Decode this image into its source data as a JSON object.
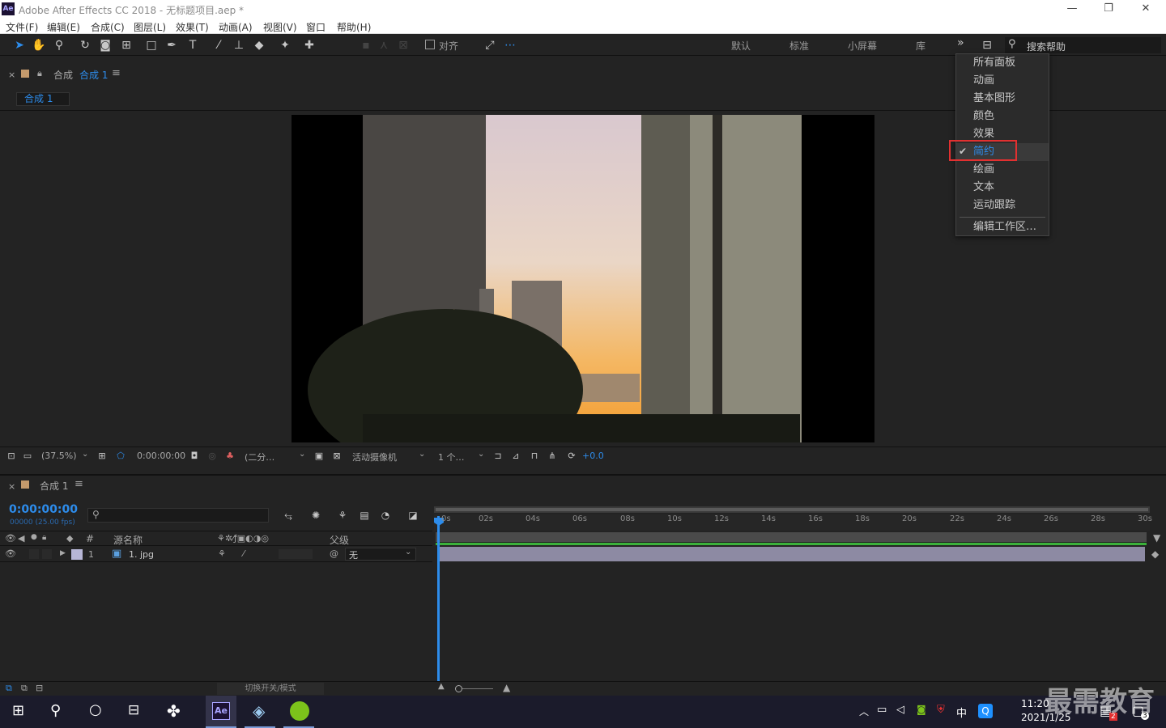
{
  "app": {
    "title": "Adobe After Effects CC 2018 - 无标题项目.aep *",
    "logo_text": "Ae",
    "win_minimize": "—",
    "win_restore": "❐",
    "win_close": "✕"
  },
  "menu": [
    "文件(F)",
    "编辑(E)",
    "合成(C)",
    "图层(L)",
    "效果(T)",
    "动画(A)",
    "视图(V)",
    "窗口",
    "帮助(H)"
  ],
  "toolbar": {
    "align_label": "对齐",
    "workspaces": [
      "默认",
      "标准",
      "小屏幕",
      "库"
    ],
    "more": "»",
    "search_placeholder": "搜索帮助"
  },
  "workspace_menu": {
    "items": [
      "所有面板",
      "动画",
      "基本图形",
      "颜色",
      "效果",
      "简约",
      "绘画",
      "文本",
      "运动跟踪"
    ],
    "checked_item": "简约",
    "edit_item": "编辑工作区…"
  },
  "comp_panel": {
    "close": "×",
    "label": "合成",
    "name": "合成 1",
    "tab": "合成 1"
  },
  "viewer_controls": {
    "zoom": "(37.5%)",
    "timecode": "0:00:00:00",
    "resolution": "(二分…",
    "camera": "活动摄像机",
    "views": "1 个…",
    "exposure": "+0.0"
  },
  "timeline": {
    "close": "×",
    "comp_name": "合成 1",
    "timecode": "0:00:00:00",
    "fps_info": "00000 (25.00 fps)",
    "columns": {
      "num": "#",
      "source": "源名称",
      "parent": "父级"
    },
    "ticks": [
      "0s",
      "02s",
      "04s",
      "06s",
      "08s",
      "10s",
      "12s",
      "14s",
      "16s",
      "18s",
      "20s",
      "22s",
      "24s",
      "26s",
      "28s",
      "30s"
    ],
    "layers": [
      {
        "num": "1",
        "name": "1. jpg",
        "parent": "无",
        "label_color": "#b7b6d6"
      }
    ],
    "toggle_label": "切换开关/模式"
  },
  "taskbar": {
    "time": "11:20",
    "date": "2021/1/25",
    "ime": "中",
    "notif_badge": "2",
    "notif_count": "3",
    "watermark": "最需教育"
  },
  "colors": {
    "accent_blue": "#2d8ceb",
    "highlight_red": "#e23030",
    "layer_bar": "#8d8aa3",
    "work_area_green": "#3bb13b"
  }
}
